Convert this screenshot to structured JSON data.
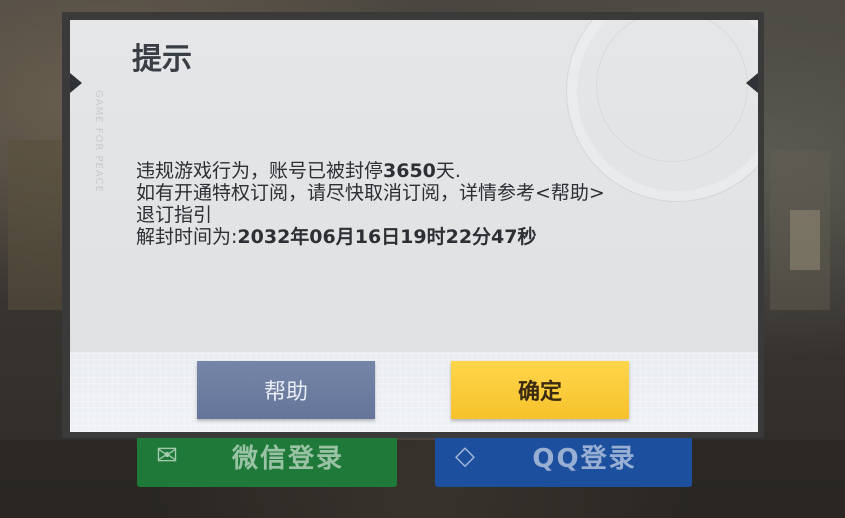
{
  "dialog": {
    "title": "提示",
    "message": {
      "line1_prefix": "违规游戏行为，账号已被封停",
      "ban_days": "3650",
      "line1_suffix": "天.",
      "line2": "如有开通特权订阅，请尽快取消订阅，详情参考<帮助>",
      "line3": "退订指引",
      "line4_prefix": "解封时间为:",
      "unban_time": "2032年06月16日19时22分47秒"
    },
    "buttons": {
      "help_label": "帮助",
      "ok_label": "确定"
    },
    "watermark": "GAME FOR PEACE"
  },
  "background": {
    "wechat_login_label": "微信登录",
    "qq_login_label": "QQ登录"
  },
  "colors": {
    "help_button": "#6b7ba0",
    "ok_button": "#f9c936",
    "wechat": "#1f7a3a",
    "qq": "#1c4f9e"
  }
}
